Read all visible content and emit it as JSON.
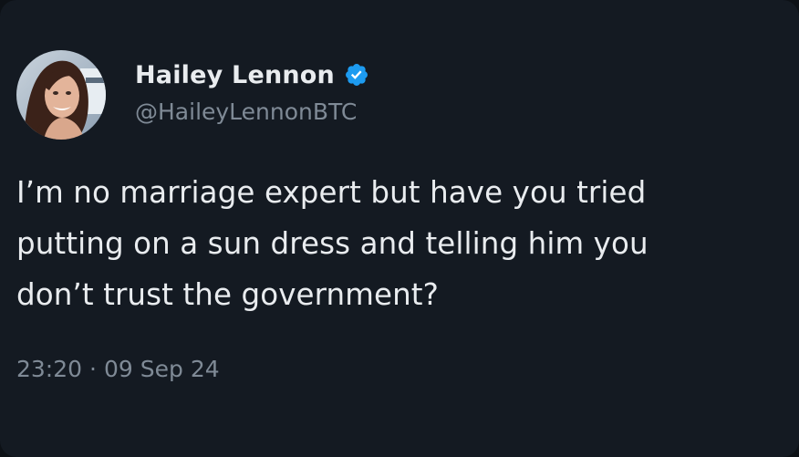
{
  "tweet": {
    "author": {
      "display_name": "Hailey Lennon",
      "handle": "@HaileyLennonBTC",
      "verified": true,
      "verified_color": "#1d9bf0"
    },
    "text": "I’m no marriage expert but have you tried\nputting on a sun dress and telling him you\ndon’t trust the government?",
    "time": "23:20",
    "separator": "·",
    "date": "09 Sep 24"
  },
  "icons": {
    "verified": "verified-badge-icon",
    "avatar": "profile-photo"
  },
  "colors": {
    "background": "#141a22",
    "text_primary": "#e9ecef",
    "text_secondary": "#7f8a96"
  }
}
